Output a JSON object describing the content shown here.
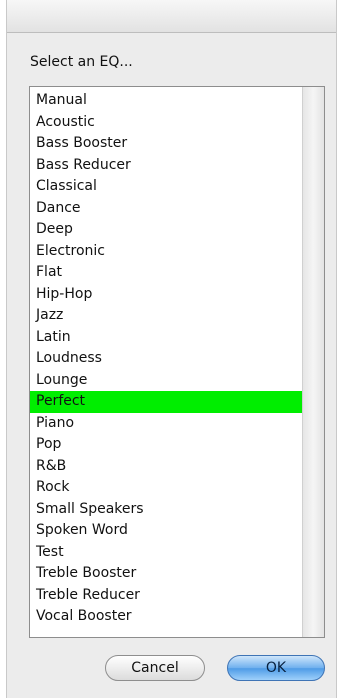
{
  "dialog": {
    "prompt": "Select an EQ...",
    "selected_index": 14,
    "selected_color": "#00ee00",
    "presets": [
      "Manual",
      "Acoustic",
      "Bass Booster",
      "Bass Reducer",
      "Classical",
      "Dance",
      "Deep",
      "Electronic",
      "Flat",
      "Hip-Hop",
      "Jazz",
      "Latin",
      "Loudness",
      "Lounge",
      "Perfect",
      "Piano",
      "Pop",
      "R&B",
      "Rock",
      "Small Speakers",
      "Spoken Word",
      "Test",
      "Treble Booster",
      "Treble Reducer",
      "Vocal Booster"
    ]
  },
  "buttons": {
    "cancel_label": "Cancel",
    "ok_label": "OK"
  }
}
